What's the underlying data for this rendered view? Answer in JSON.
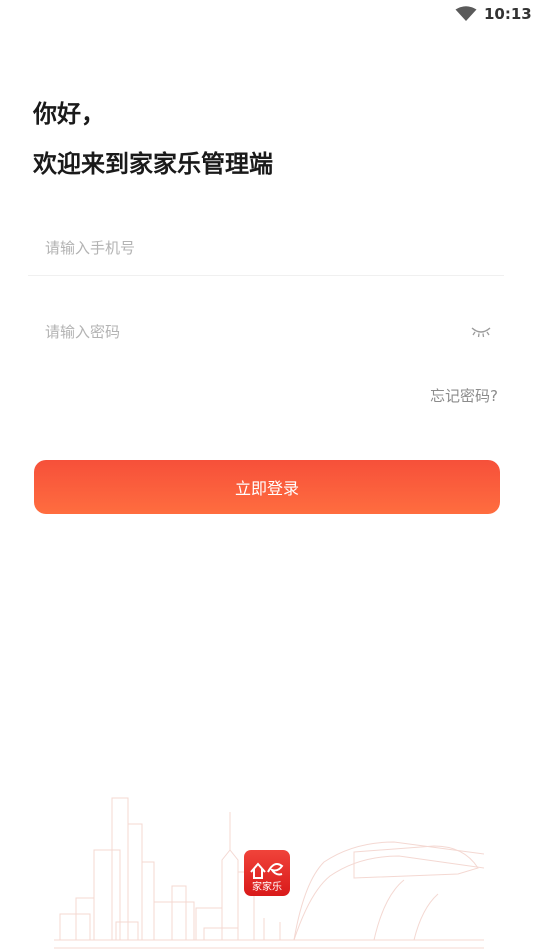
{
  "status_bar": {
    "time": "10:13",
    "icons": [
      "wifi-icon"
    ]
  },
  "greeting": {
    "line1": "你好，",
    "line2": "欢迎来到家家乐管理端"
  },
  "form": {
    "phone_placeholder": "请输入手机号",
    "password_placeholder": "请输入密码",
    "password_toggle_icon": "eye-closed-icon",
    "forgot_label": "忘记密码?",
    "login_label": "立即登录"
  },
  "footer": {
    "logo_text": "家家乐"
  },
  "colors": {
    "accent": "#f6503a",
    "accent_end": "#ff6d3f",
    "placeholder": "#b3b3b3"
  }
}
